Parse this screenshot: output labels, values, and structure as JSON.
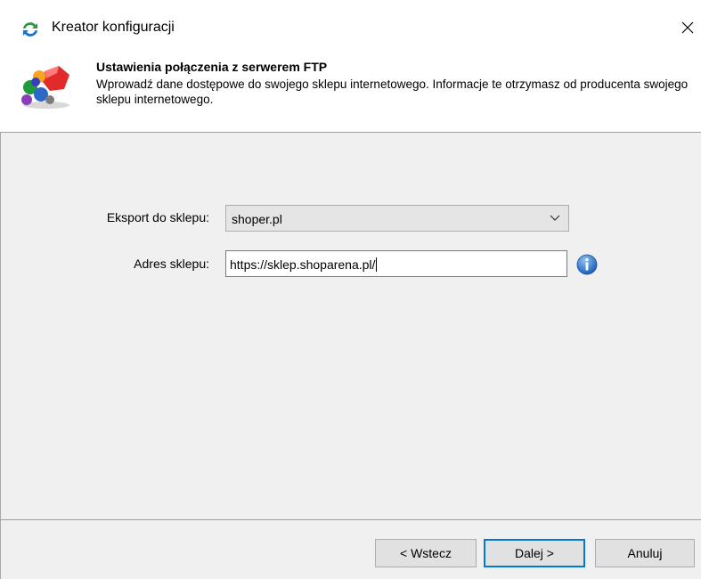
{
  "window": {
    "title": "Kreator konfiguracji"
  },
  "header": {
    "title": "Ustawienia połączenia z serwerem FTP",
    "description": "Wprowadź dane dostępowe do swojego sklepu internetowego. Informacje te otrzymasz od producenta swojego sklepu internetowego."
  },
  "form": {
    "export_label": "Eksport do sklepu:",
    "export_value": "shoper.pl",
    "address_label": "Adres sklepu:",
    "address_value": "https://sklep.shoparena.pl/"
  },
  "buttons": {
    "back": "< Wstecz",
    "next": "Dalej >",
    "cancel": "Anuluj"
  },
  "colors": {
    "accent": "#0078d7",
    "info": "#2b7cd3"
  },
  "icons": {
    "title": "refresh-arrows-icon",
    "header": "wizard-shapes-icon",
    "close": "close-icon",
    "dropdown": "chevron-down-icon",
    "info": "info-icon"
  }
}
